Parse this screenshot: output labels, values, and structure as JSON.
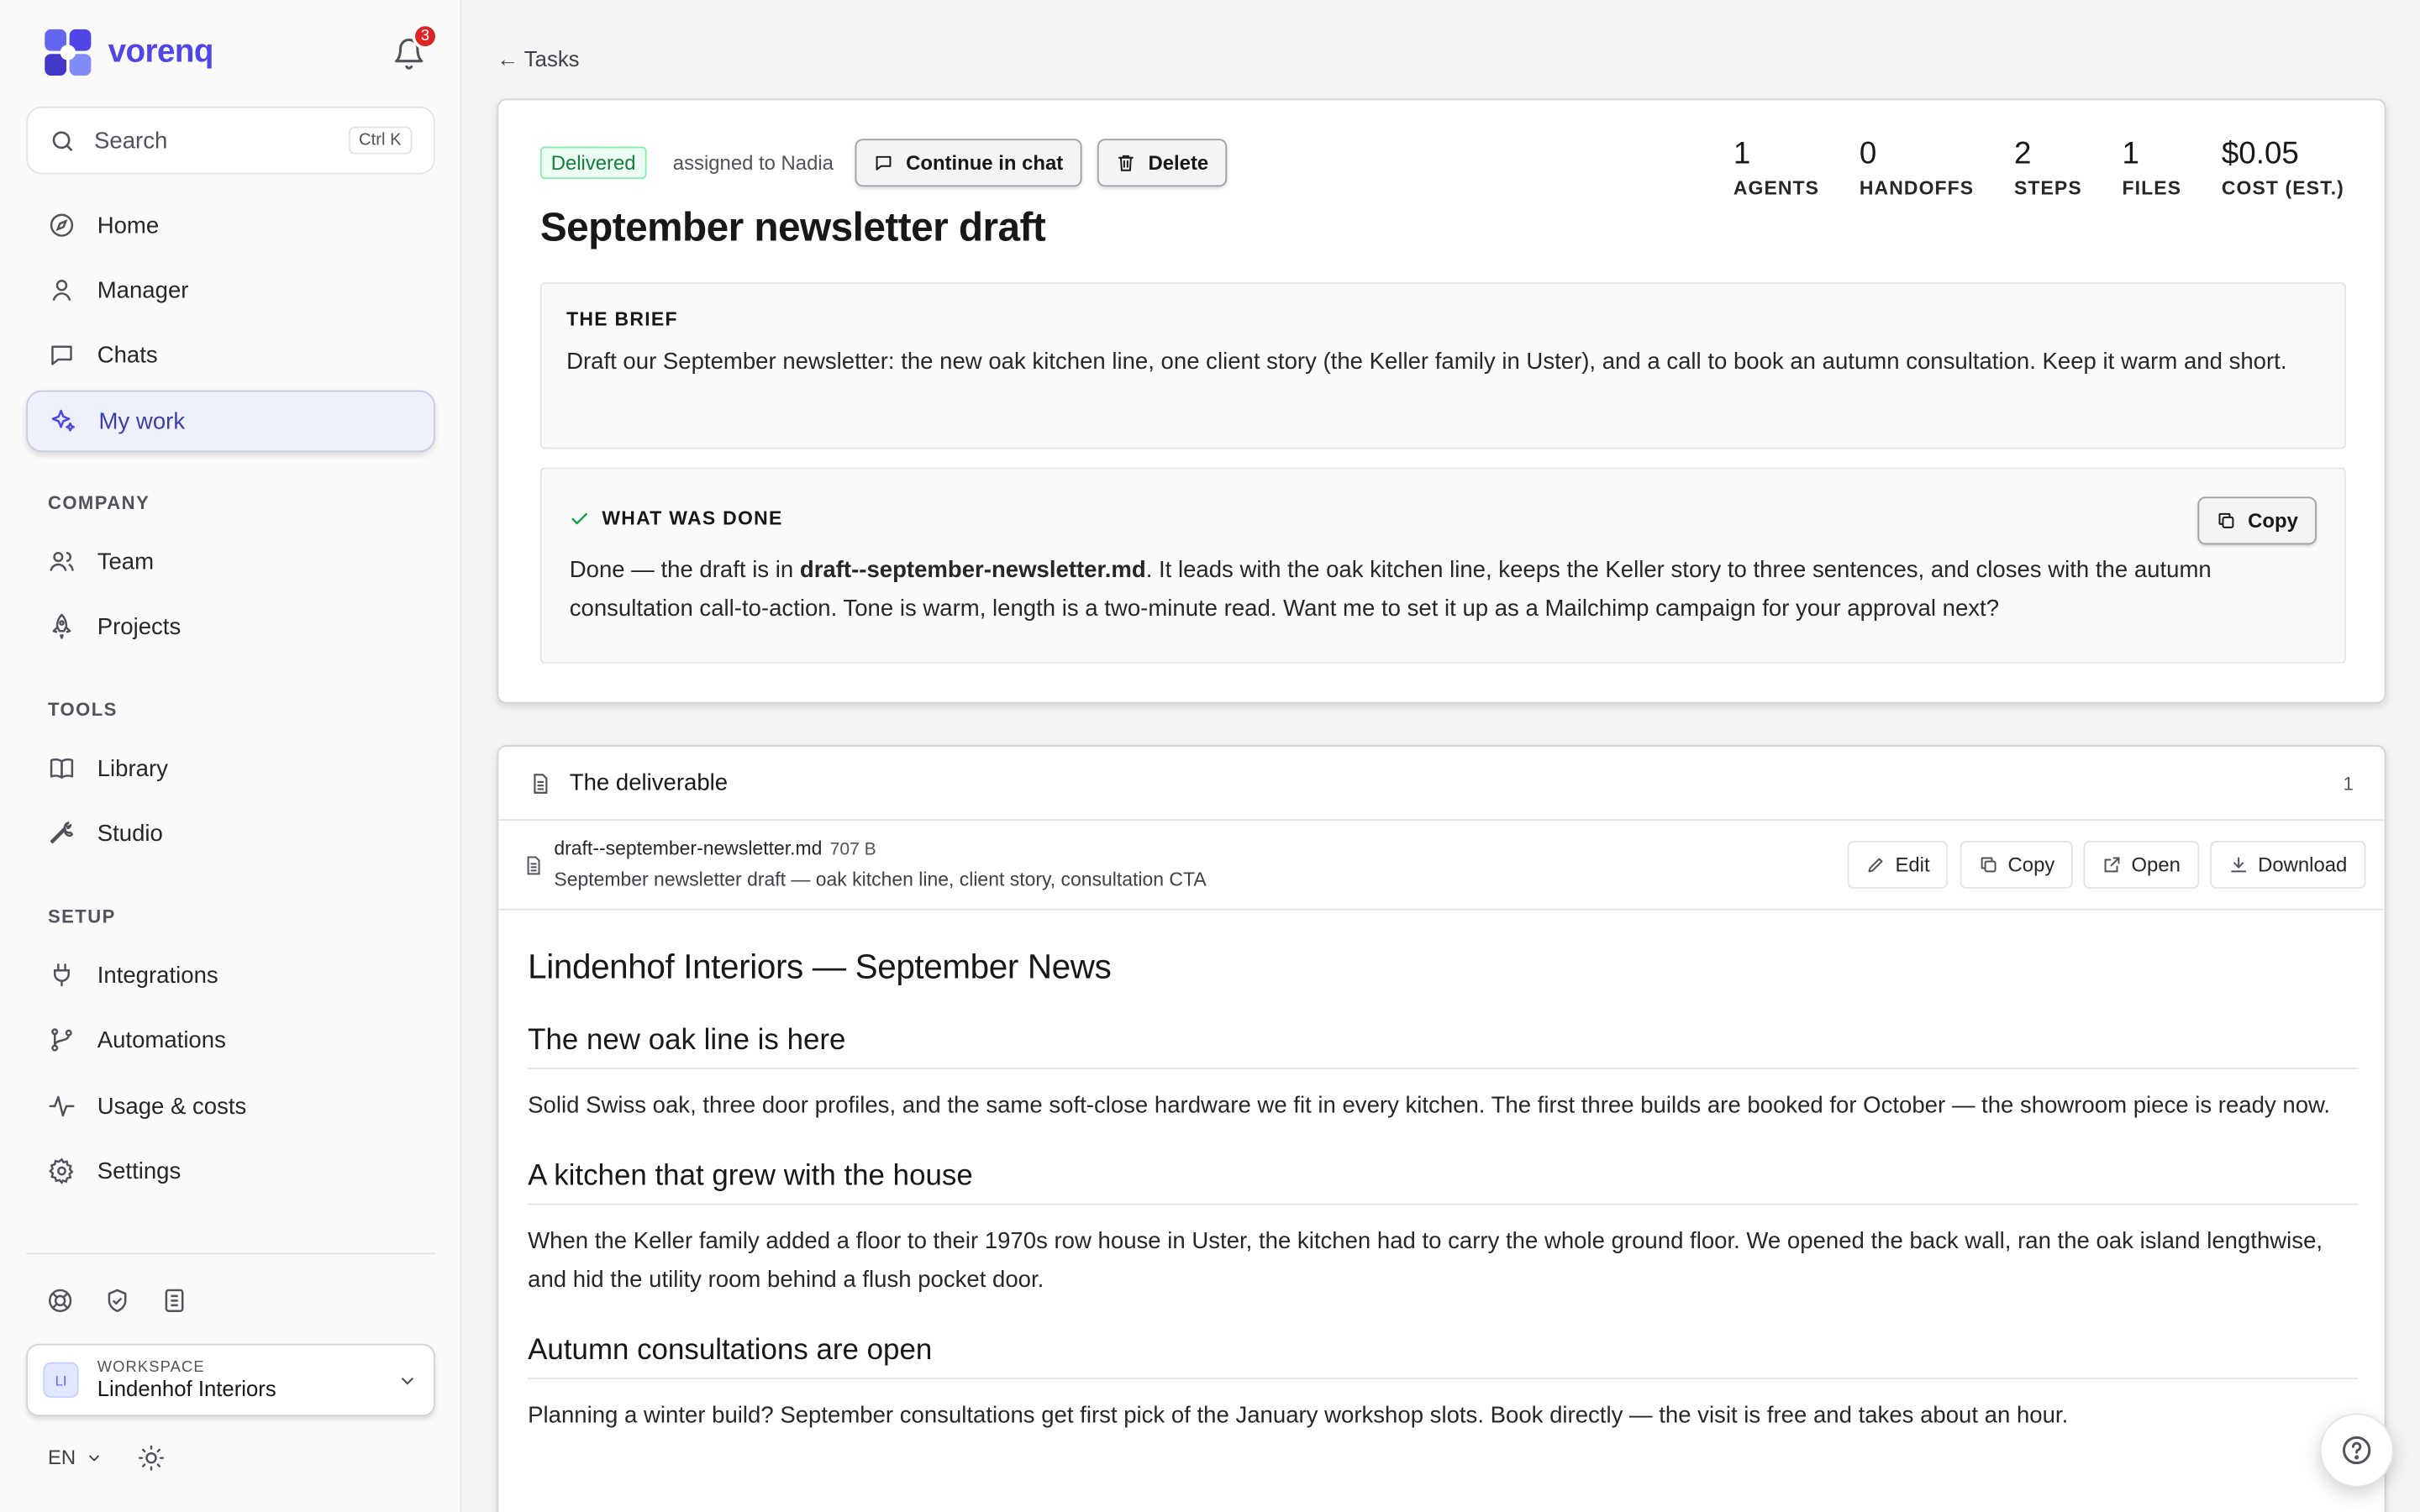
{
  "brand": {
    "name": "vorenq",
    "accent": "#4f46e5"
  },
  "notifications": {
    "count": "3"
  },
  "search": {
    "label": "Search",
    "shortcut": "Ctrl K"
  },
  "nav": {
    "main": [
      {
        "label": "Home",
        "icon": "compass-icon"
      },
      {
        "label": "Manager",
        "icon": "user-icon"
      },
      {
        "label": "Chats",
        "icon": "chat-icon"
      },
      {
        "label": "My work",
        "icon": "sparkle-icon",
        "active": true
      }
    ],
    "company_label": "COMPANY",
    "company": [
      {
        "label": "Team",
        "icon": "users-icon"
      },
      {
        "label": "Projects",
        "icon": "rocket-icon"
      }
    ],
    "tools_label": "TOOLS",
    "tools": [
      {
        "label": "Library",
        "icon": "book-icon"
      },
      {
        "label": "Studio",
        "icon": "wrench-icon"
      }
    ],
    "setup_label": "SETUP",
    "setup": [
      {
        "label": "Integrations",
        "icon": "plug-icon"
      },
      {
        "label": "Automations",
        "icon": "branch-icon"
      },
      {
        "label": "Usage & costs",
        "icon": "activity-icon"
      },
      {
        "label": "Settings",
        "icon": "gear-icon"
      }
    ]
  },
  "workspace": {
    "caption": "WORKSPACE",
    "initials": "LI",
    "name": "Lindenhof Interiors"
  },
  "footer": {
    "language": "EN"
  },
  "back": {
    "label": "← Tasks"
  },
  "task": {
    "status": "Delivered",
    "assigned": "assigned to Nadia",
    "continue_label": "Continue in chat",
    "delete_label": "Delete",
    "title": "September newsletter draft",
    "stats": [
      {
        "value": "1",
        "label": "AGENTS"
      },
      {
        "value": "0",
        "label": "HANDOFFS"
      },
      {
        "value": "2",
        "label": "STEPS"
      },
      {
        "value": "1",
        "label": "FILES"
      },
      {
        "value": "$0.05",
        "label": "COST (EST.)"
      }
    ],
    "brief_heading": "THE BRIEF",
    "brief_text": "Draft our September newsletter: the new oak kitchen line, one client story (the Keller family in Uster), and a call to book an autumn consultation. Keep it warm and short.",
    "done_heading": "WHAT WAS DONE",
    "copy_label": "Copy",
    "done_pre": "Done — the draft is in ",
    "done_file": "draft--september-newsletter.md",
    "done_post": ". It leads with the oak kitchen line, keeps the Keller story to three sentences, and closes with the autumn consultation call-to-action. Tone is warm, length is a two-minute read. Want me to set it up as a Mailchimp campaign for your approval next?"
  },
  "deliverable": {
    "heading": "The deliverable",
    "count": "1",
    "file": {
      "name": "draft--september-newsletter.md",
      "size": "707 B",
      "description": "September newsletter draft — oak kitchen line, client story, consultation CTA"
    },
    "actions": {
      "edit": "Edit",
      "copy": "Copy",
      "open": "Open",
      "download": "Download"
    },
    "doc": {
      "h1": "Lindenhof Interiors — September News",
      "sections": [
        {
          "h2": "The new oak line is here",
          "p": "Solid Swiss oak, three door profiles, and the same soft-close hardware we fit in every kitchen. The first three builds are booked for October — the showroom piece is ready now."
        },
        {
          "h2": "A kitchen that grew with the house",
          "p": "When the Keller family added a floor to their 1970s row house in Uster, the kitchen had to carry the whole ground floor. We opened the back wall, ran the oak island lengthwise, and hid the utility room behind a flush pocket door."
        },
        {
          "h2": "Autumn consultations are open",
          "p": "Planning a winter build? September consultations get first pick of the January workshop slots. Book directly — the visit is free and takes about an hour."
        }
      ]
    }
  }
}
